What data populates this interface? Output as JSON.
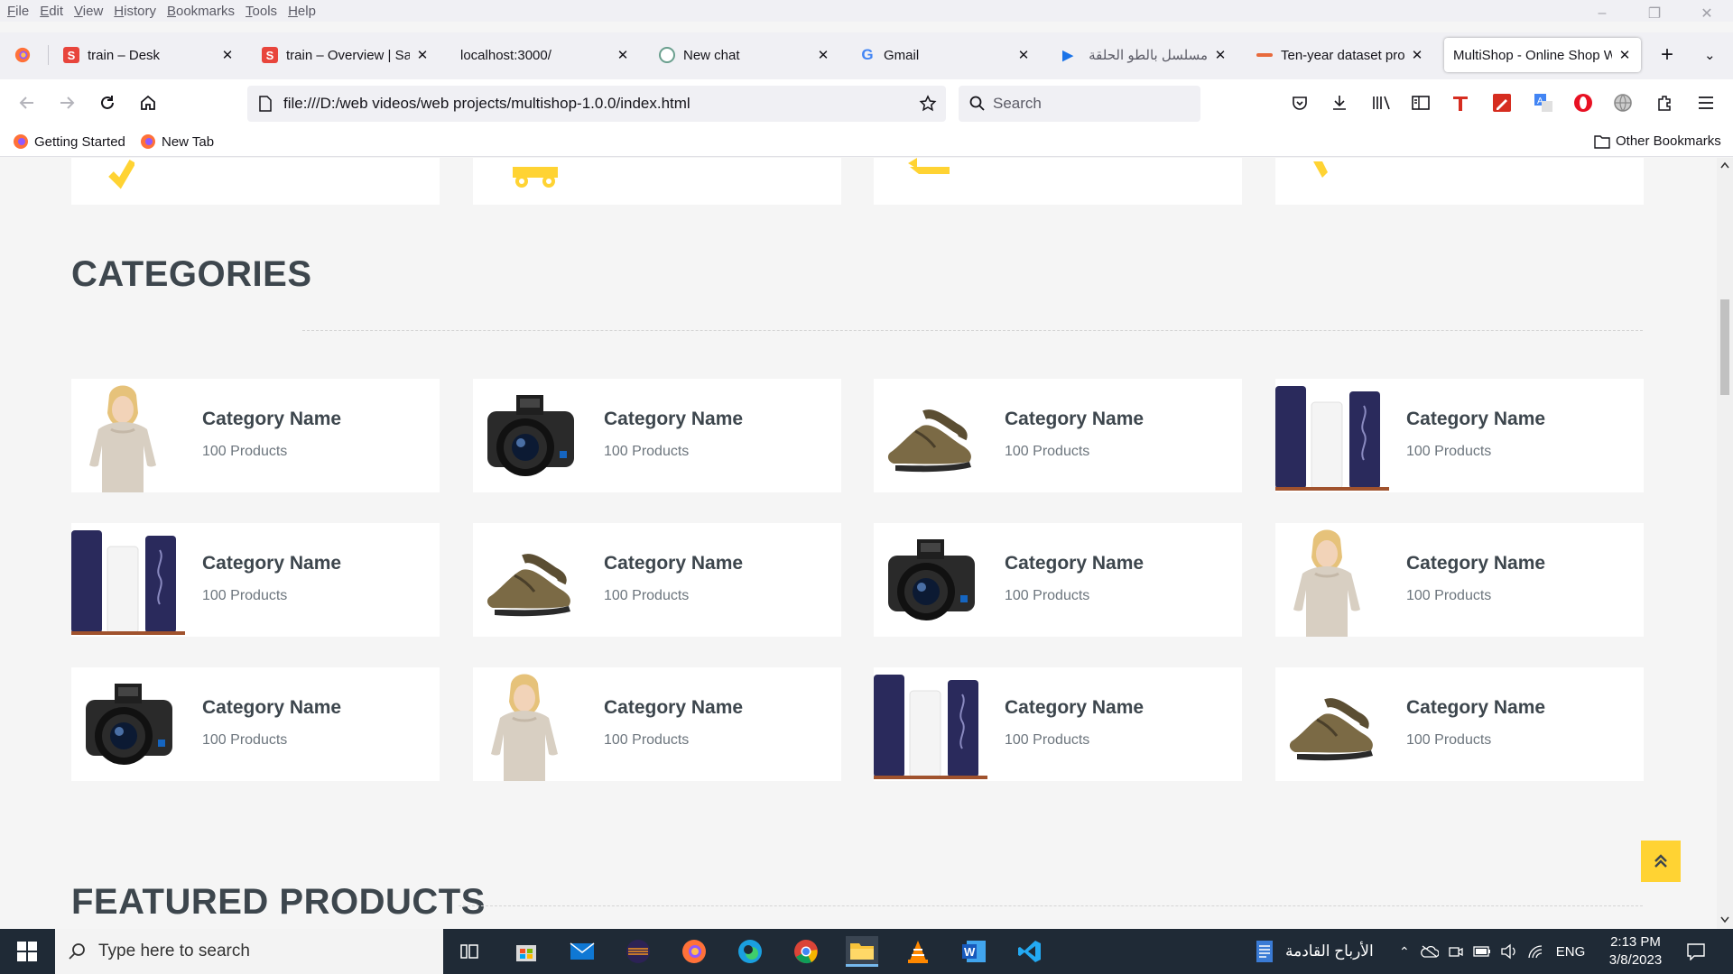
{
  "browser": {
    "menu": [
      "File",
      "Edit",
      "View",
      "History",
      "Bookmarks",
      "Tools",
      "Help"
    ],
    "tabs": [
      {
        "title": "train – Desk",
        "icon": "s-logo-icon"
      },
      {
        "title": "train – Overview | Sani",
        "icon": "s-logo-icon"
      },
      {
        "title": "localhost:3000/",
        "icon": ""
      },
      {
        "title": "New chat",
        "icon": "chatgpt-icon"
      },
      {
        "title": "Gmail",
        "icon": "google-icon"
      },
      {
        "title": "مسلسل بالطو الحلقة ؟",
        "icon": "play-icon"
      },
      {
        "title": "Ten-year dataset provi",
        "icon": "dataset-icon"
      },
      {
        "title": "MultiShop - Online Shop W",
        "icon": ""
      }
    ],
    "url": "file:///D:/web videos/web projects/multishop-1.0.0/index.html",
    "search_placeholder": "Search",
    "bookmarks": {
      "getting_started": "Getting Started",
      "new_tab": "New Tab",
      "other": "Other Bookmarks"
    }
  },
  "page": {
    "categories_title": "CATEGORIES",
    "featured_title": "FEATURED PRODUCTS",
    "categories": [
      {
        "name": "Category Name",
        "count": "100 Products",
        "image": "woman-sweater"
      },
      {
        "name": "Category Name",
        "count": "100 Products",
        "image": "camera"
      },
      {
        "name": "Category Name",
        "count": "100 Products",
        "image": "shoes"
      },
      {
        "name": "Category Name",
        "count": "100 Products",
        "image": "cosmetics"
      },
      {
        "name": "Category Name",
        "count": "100 Products",
        "image": "cosmetics"
      },
      {
        "name": "Category Name",
        "count": "100 Products",
        "image": "shoes"
      },
      {
        "name": "Category Name",
        "count": "100 Products",
        "image": "camera"
      },
      {
        "name": "Category Name",
        "count": "100 Products",
        "image": "woman-sweater"
      },
      {
        "name": "Category Name",
        "count": "100 Products",
        "image": "camera"
      },
      {
        "name": "Category Name",
        "count": "100 Products",
        "image": "woman-sweater"
      },
      {
        "name": "Category Name",
        "count": "100 Products",
        "image": "cosmetics"
      },
      {
        "name": "Category Name",
        "count": "100 Products",
        "image": "shoes"
      }
    ],
    "accent_color": "#FFD333"
  },
  "taskbar": {
    "search_placeholder": "Type here to search",
    "weather_text": "الأرباح القادمة",
    "language": "ENG",
    "time": "2:13 PM",
    "date": "3/8/2023"
  }
}
